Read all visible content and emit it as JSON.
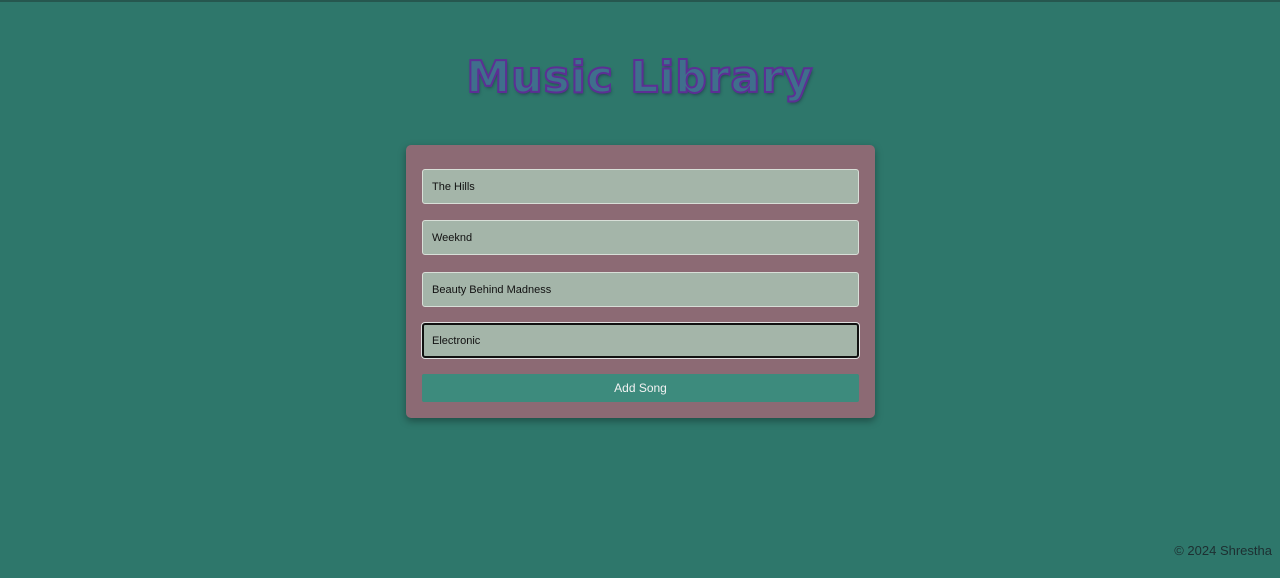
{
  "page": {
    "title": "Music Library"
  },
  "form": {
    "fields": [
      {
        "name": "song-title",
        "value": "The Hills"
      },
      {
        "name": "artist",
        "value": "Weeknd"
      },
      {
        "name": "album",
        "value": "Beauty Behind Madness"
      },
      {
        "name": "genre",
        "value": "Electronic"
      }
    ],
    "submit_label": "Add Song"
  },
  "footer": {
    "text": "© 2024 Shrestha"
  },
  "colors": {
    "background": "#2e776b",
    "card": "#8c6a74",
    "input": "#a4b5a9",
    "button": "#3d8b7d",
    "title_outline": "#5c2f94"
  }
}
